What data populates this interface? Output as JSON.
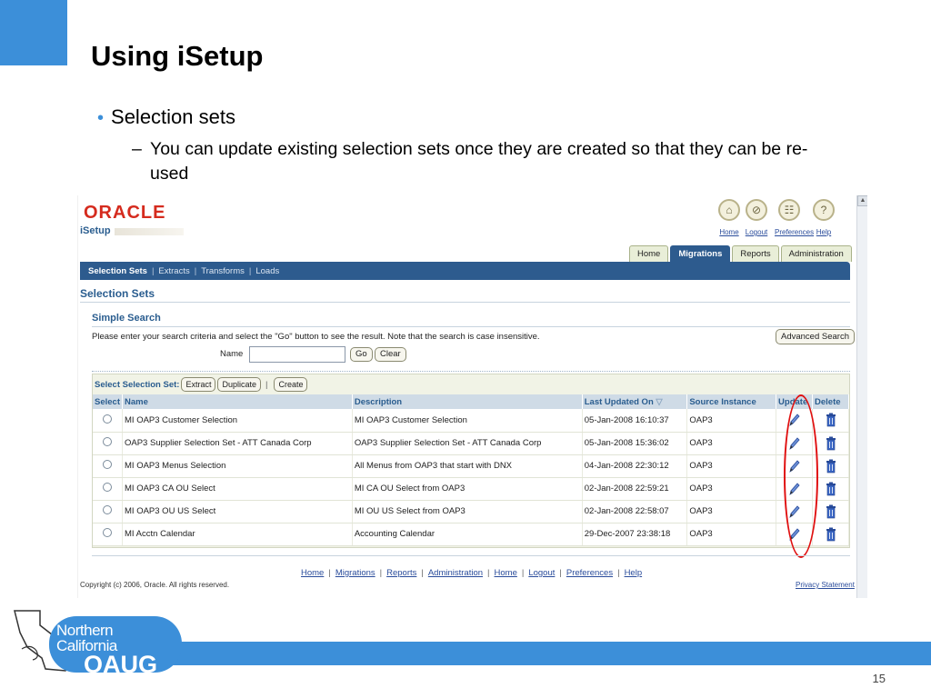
{
  "slide": {
    "title": "Using iSetup",
    "bullet_1": "Selection sets",
    "bullet_2": "You can update existing selection sets once they are created so that they can be re-used",
    "page_number": "15",
    "logo": {
      "line1": "Northern",
      "line2": "California",
      "line3": "OAUG"
    },
    "accent_color": "#3c8fd9"
  },
  "app": {
    "brand": "ORACLE",
    "product": "iSetup",
    "global_buttons": [
      {
        "label": "Home",
        "icon": "house-icon"
      },
      {
        "label": "Logout",
        "icon": "logout-icon"
      },
      {
        "label": "Preferences",
        "icon": "preferences-icon"
      },
      {
        "label": "Help",
        "icon": "help-icon"
      }
    ],
    "tabs": [
      "Home",
      "Migrations",
      "Reports",
      "Administration"
    ],
    "active_tab": "Migrations",
    "subtabs": [
      "Selection Sets",
      "Extracts",
      "Transforms",
      "Loads"
    ],
    "active_subtab": "Selection Sets",
    "page_heading": "Selection Sets",
    "search": {
      "title": "Simple Search",
      "hint": "Please enter your search criteria and select the \"Go\" button to see the result. Note that the search is case insensitive.",
      "advanced_label": "Advanced Search",
      "name_label": "Name",
      "name_value": "",
      "go_label": "Go",
      "clear_label": "Clear"
    },
    "table": {
      "select_bar_label": "Select Selection Set:",
      "bar_buttons": [
        "Extract",
        "Duplicate"
      ],
      "create_label": "Create",
      "columns": [
        "Select",
        "Name",
        "Description",
        "Last Updated On",
        "Source Instance",
        "Update",
        "Delete"
      ],
      "rows": [
        {
          "name": "MI OAP3 Customer Selection",
          "description": "MI OAP3 Customer Selection",
          "updated": "05-Jan-2008 16:10:37",
          "source": "OAP3"
        },
        {
          "name": "OAP3 Supplier Selection Set - ATT Canada Corp",
          "description": "OAP3 Supplier Selection Set - ATT Canada Corp",
          "updated": "05-Jan-2008 15:36:02",
          "source": "OAP3"
        },
        {
          "name": "MI OAP3 Menus Selection",
          "description": "All Menus from OAP3 that start with DNX",
          "updated": "04-Jan-2008 22:30:12",
          "source": "OAP3"
        },
        {
          "name": "MI OAP3 CA OU Select",
          "description": "MI CA OU Select from OAP3",
          "updated": "02-Jan-2008 22:59:21",
          "source": "OAP3"
        },
        {
          "name": "MI OAP3 OU US Select",
          "description": "MI OU US Select from OAP3",
          "updated": "02-Jan-2008 22:58:07",
          "source": "OAP3"
        },
        {
          "name": "MI Acctn Calendar",
          "description": "Accounting Calendar",
          "updated": "29-Dec-2007 23:38:18",
          "source": "OAP3"
        }
      ]
    },
    "footer_links": [
      "Home",
      "Migrations",
      "Reports",
      "Administration",
      "Home",
      "Logout",
      "Preferences",
      "Help"
    ],
    "copyright": "Copyright (c) 2006, Oracle. All rights reserved.",
    "privacy": "Privacy Statement",
    "colors": {
      "brand_red": "#d52b1e",
      "nav_blue": "#2d5b8e",
      "heading_blue": "#2a5d8f",
      "highlight_red": "#e01010"
    }
  }
}
